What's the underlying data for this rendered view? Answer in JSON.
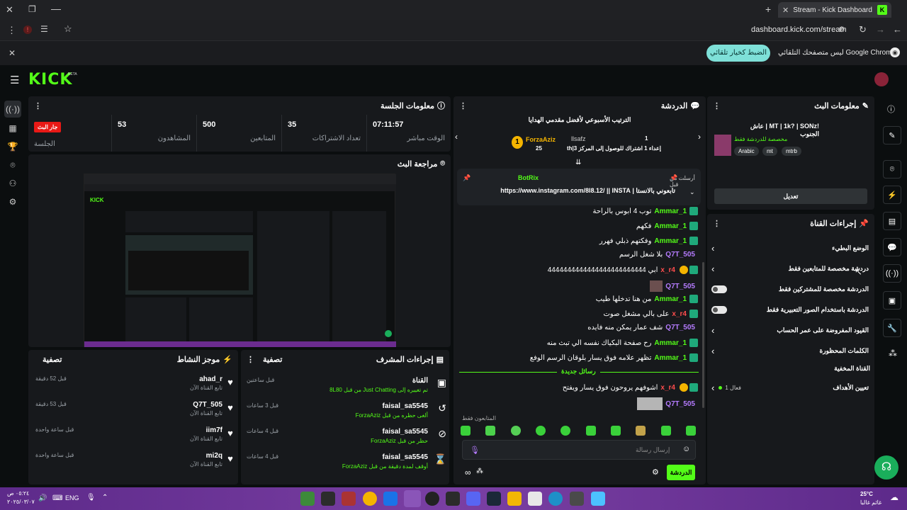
{
  "browser": {
    "tab_title": "Stream - Kick Dashboard",
    "url": "dashboard.kick.com/stream",
    "new_tab": "+",
    "notification_text": "Google Chrome ليس متصفحك التلقائي",
    "notification_button": "الضبط كخيار تلقائي"
  },
  "kick": {
    "logo": "KICK",
    "beta": "BETA"
  },
  "session": {
    "title": "معلومات الجلسة",
    "live_badge": "جار البث",
    "live_label": "الجلسة",
    "stats": [
      {
        "value": "07:11:57",
        "label": "الوقت مباشر"
      },
      {
        "value": "35",
        "label": "تعداد الاشتراكات"
      },
      {
        "value": "500",
        "label": "المتابعين"
      },
      {
        "value": "53",
        "label": "المشاهدون"
      }
    ]
  },
  "preview": {
    "title": "مراجعة البث"
  },
  "activity": {
    "title": "موجز النشاط",
    "filter": "تصفية",
    "items": [
      {
        "user": "ahad_r",
        "sub": "تابع القناة الآن",
        "time": "قبل 52 دقيقة"
      },
      {
        "user": "Q7T_505",
        "sub": "تابع القناة الآن",
        "time": "قبل 53 دقيقة"
      },
      {
        "user": "iim7f",
        "sub": "تابع القناة الآن",
        "time": "قبل ساعة واحدة"
      },
      {
        "user": "mi2q",
        "sub": "تابع القناة الآن",
        "time": "قبل ساعة واحدة"
      }
    ]
  },
  "modactions": {
    "title": "إجراءات المشرف",
    "filter": "تصفية",
    "items": [
      {
        "title": "القناة",
        "sub": "تم تغييره إلى Just Chatting من قبل 8L80",
        "time": "قبل ساعتين"
      },
      {
        "title": "faisal_sa5545",
        "sub": "ألغى حظره من قبل ForzaAziz",
        "time": "قبل 3 ساعات"
      },
      {
        "title": "faisal_sa5545",
        "sub": "حظر من قبل ForzaAziz",
        "time": "قبل 4 ساعات"
      },
      {
        "title": "faisal_sa5545",
        "sub": "أوقف لمدة دقيقة من قبل ForzaAziz",
        "time": "قبل 4 ساعات"
      }
    ]
  },
  "chat": {
    "title": "الدردشة",
    "leaderboard_title": "الترتيب الأسبوعي لأفضل مقدمي الهدايا",
    "leader1_name": "ForzaAziz",
    "leader1_count": "25",
    "leader2_name": "llsafz",
    "leader2_count": "1",
    "leader2_sub": "th|إعداء 1 اشتراك للوصول إلى المركز 3",
    "pinned_by": "أرسلت من قبل",
    "pinned_user": "BotRix",
    "pinned_text": "تابعوني بالانستا | https://www.instagram.com/8l8.12/ || INSTA",
    "messages": [
      {
        "user": "1_Ammar",
        "text": "توب 4 ابوس بالراحة"
      },
      {
        "user": "1_Ammar",
        "text": "فكهم"
      },
      {
        "user": "1_Ammar",
        "text": "وفكتهم ذبلي فهرر"
      },
      {
        "user": "Q7T_505",
        "text": "بلا شغل الرسم"
      },
      {
        "user": "x_r4",
        "text": "ابي 4444444444444444444444444"
      },
      {
        "user": "Q7T_505",
        "text": ""
      },
      {
        "user": "1_Ammar",
        "text": "من هنا تدخلها طيب"
      },
      {
        "user": "x_r4",
        "text": "على بالي مشغل صوت"
      },
      {
        "user": "Q7T_505",
        "text": "شف عمار يمكن منه فايده"
      },
      {
        "user": "1_Ammar",
        "text": "رح صفحة البكياك نفسه الي تبث منه"
      },
      {
        "user": "1_Ammar",
        "text": "تظهر علامه فوق يسار بلوقان الرسم الوفع"
      }
    ],
    "new_messages": "رسائل جديدة",
    "after": [
      {
        "user": "x_r4",
        "text": "اشوفهم يروحون فوق يسار ويفتح"
      },
      {
        "user": "Q7T_505",
        "text": ""
      }
    ],
    "followers_only": "المتابعون فقط",
    "input_placeholder": "إرسال رسالة",
    "send_button": "الدردشة"
  },
  "streaminfo": {
    "title": "معلومات البث",
    "stream_title": "!MT | 1k? | SONz | عاش الجنوب",
    "category": "مخصصة للدردشة فقط",
    "tags": [
      "Arabic",
      "mt",
      "mtrb"
    ],
    "edit_button": "تعديل"
  },
  "channel": {
    "title": "إجراءات القناة",
    "items": [
      {
        "label": "الوضع البطيء",
        "control": "arrow"
      },
      {
        "label": "دردشة مخصصة للمتابعين فقط",
        "control": "arrow"
      },
      {
        "label": "الدردشة مخصصة للمشتركين فقط",
        "control": "toggle"
      },
      {
        "label": "الدردشة باستخدام الصور التعبيرية فقط",
        "control": "toggle"
      },
      {
        "label": "القيود المفروضة على عمر الحساب",
        "control": "arrow"
      },
      {
        "label": "الكلمات المحظورة",
        "control": "arrow"
      }
    ],
    "hidden_section": "القناة المخفية",
    "goals_label": "تعيين الأهداف",
    "goals_status": "فعال 1"
  },
  "taskbar": {
    "lang": "ENG",
    "time": "٠٥:٢٤ ص",
    "date": "٢٠٢٥/٠٣/٠٧",
    "temp": "25°C",
    "weather": "غائم غالبا"
  }
}
